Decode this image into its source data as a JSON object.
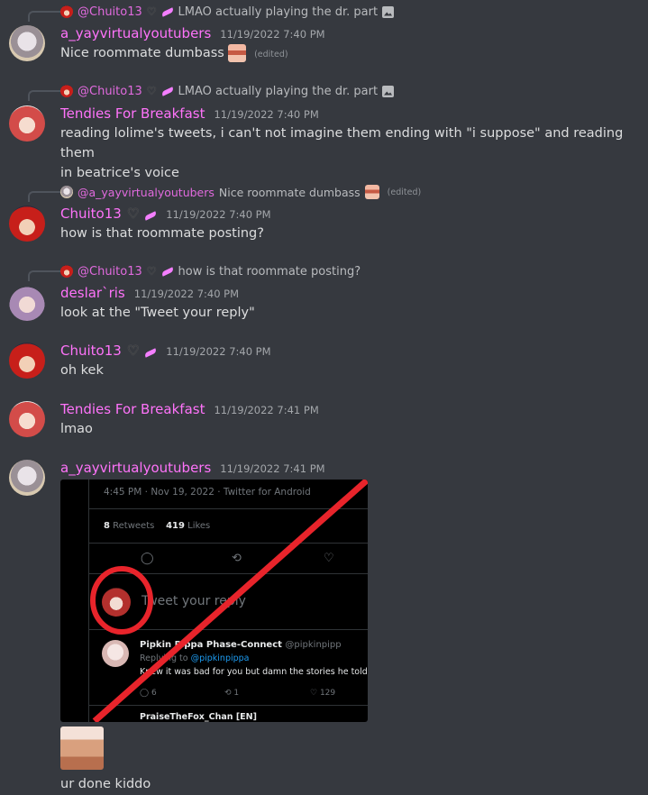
{
  "messages": [
    {
      "reply": {
        "user": "@Chuito13",
        "text": "LMAO actually playing the dr. part",
        "has_image_icon": true
      },
      "user": "a_yayvirtualyoutubers",
      "timestamp": "11/19/2022 7:40 PM",
      "text": "Nice roommate dumbass",
      "edited": "(edited)"
    },
    {
      "reply": {
        "user": "@Chuito13",
        "text": "LMAO actually playing the dr. part",
        "has_image_icon": true
      },
      "user": "Tendies For Breakfast",
      "timestamp": "11/19/2022 7:40 PM",
      "text_line1": "reading lolime's tweets, i can't not imagine them ending with \"i suppose\" and reading them",
      "text_line2": "in beatrice's voice"
    },
    {
      "reply": {
        "user": "@a_yayvirtualyoutubers",
        "text": "Nice roommate dumbass",
        "edited": "(edited)"
      },
      "user": "Chuito13",
      "timestamp": "11/19/2022 7:40 PM",
      "text": "how is that roommate posting?"
    },
    {
      "reply": {
        "user": "@Chuito13",
        "text": "how is that roommate posting?"
      },
      "user": "deslar`ris",
      "timestamp": "11/19/2022 7:40 PM",
      "text": "look at the \"Tweet your reply\""
    },
    {
      "user": "Chuito13",
      "timestamp": "11/19/2022 7:40 PM",
      "text": "oh kek"
    },
    {
      "user": "Tendies For Breakfast",
      "timestamp": "11/19/2022 7:41 PM",
      "text": "lmao"
    },
    {
      "user": "a_yayvirtualyoutubers",
      "timestamp": "11/19/2022 7:41 PM",
      "text": "ur done kiddo"
    }
  ],
  "embed": {
    "time": "4:45 PM · Nov 19, 2022 · Twitter for Android",
    "retweets_count": "8",
    "retweets_label": "Retweets",
    "likes_count": "419",
    "likes_label": "Likes",
    "reply_placeholder": "Tweet your reply",
    "reply_name": "Pipkin Pippa",
    "reply_name2": "Phase-Connect",
    "reply_handle": "@pipkinpipp",
    "replying_prefix": "Replying to",
    "replying_handle": "@pipkinpippa",
    "reply_body": "Knew it was bad for you but damn the stories he told",
    "reply_count": "6",
    "retweet_count": "1",
    "like_count": "129",
    "next_name": "PraiseTheFox_Chan [EN]"
  },
  "icons": {
    "heart": "♡",
    "comment": "◯",
    "retweet": "⟲",
    "like": "♡"
  },
  "colors": {
    "background": "#36393f",
    "username": "#ff73fa",
    "annotation": "#e8242b"
  }
}
